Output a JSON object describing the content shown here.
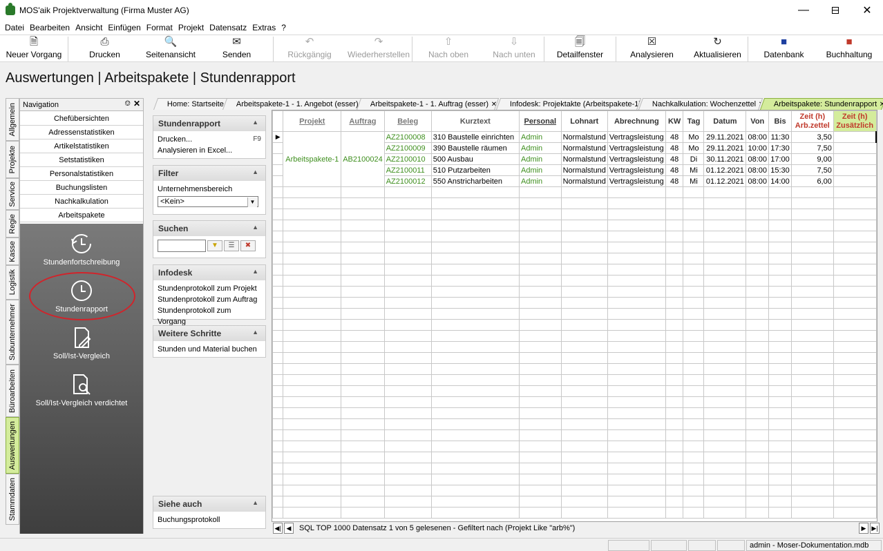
{
  "window": {
    "title": "MOS'aik Projektverwaltung (Firma Muster AG)"
  },
  "menu": [
    "Datei",
    "Bearbeiten",
    "Ansicht",
    "Einfügen",
    "Format",
    "Projekt",
    "Datensatz",
    "Extras",
    "?"
  ],
  "toolbar": {
    "neuer_vorgang": "Neuer Vorgang",
    "drucken": "Drucken",
    "seitenansicht": "Seitenansicht",
    "senden": "Senden",
    "rueckgaengig": "Rückgängig",
    "wiederherstellen": "Wiederherstellen",
    "nach_oben": "Nach oben",
    "nach_unten": "Nach unten",
    "detailfenster": "Detailfenster",
    "analysieren": "Analysieren",
    "aktualisieren": "Aktualisieren",
    "datenbank": "Datenbank",
    "buchhaltung": "Buchhaltung"
  },
  "page_title": "Auswertungen | Arbeitspakete | Stundenrapport",
  "vertical_tabs": [
    "Allgemein",
    "Projekte",
    "Service",
    "Regie",
    "Kasse",
    "Logistik",
    "Subunternehmer",
    "Büroarbeiten",
    "Auswertungen",
    "Stammdaten"
  ],
  "navigation": {
    "title": "Navigation",
    "items": [
      "Chefübersichten",
      "Adressenstatistiken",
      "Artikelstatistiken",
      "Setstatistiken",
      "Personalstatistiken",
      "Buchungslisten",
      "Nachkalkulation",
      "Arbeitspakete"
    ],
    "icons": [
      "Stundenfortschreibung",
      "Stundenrapport",
      "Soll/Ist-Vergleich",
      "Soll/Ist-Vergleich verdichtet"
    ]
  },
  "tasks": {
    "stundenrapport": {
      "title": "Stundenrapport",
      "drucken": "Drucken...",
      "drucken_key": "F9",
      "analysieren": "Analysieren in Excel..."
    },
    "filter": {
      "title": "Filter",
      "label": "Unternehmensbereich",
      "value": "<Kein>"
    },
    "suchen": {
      "title": "Suchen"
    },
    "infodesk": {
      "title": "Infodesk",
      "items": [
        "Stundenprotokoll zum Projekt",
        "Stundenprotokoll zum Auftrag",
        "Stundenprotokoll zum Vorgang"
      ]
    },
    "weitere": {
      "title": "Weitere Schritte",
      "items": [
        "Stunden und Material buchen"
      ]
    },
    "siehe": {
      "title": "Siehe auch",
      "items": [
        "Buchungsprotokoll"
      ]
    }
  },
  "doc_tabs": [
    "Home: Startseite",
    "Arbeitspakete-1 - 1. Angebot (esser)",
    "Arbeitspakete-1 - 1. Auftrag (esser)",
    "Infodesk: Projektakte (Arbeitspakete-1)",
    "Nachkalkulation: Wochenzettel",
    "Arbeitspakete: Stundenrapport"
  ],
  "grid": {
    "headers": {
      "projekt": "Projekt",
      "auftrag": "Auftrag",
      "beleg": "Beleg",
      "kurztext": "Kurztext",
      "personal": "Personal",
      "lohnart": "Lohnart",
      "abrechnung": "Abrechnung",
      "kw": "KW",
      "tag": "Tag",
      "datum": "Datum",
      "von": "Von",
      "bis": "Bis",
      "zeit1a": "Zeit (h)",
      "zeit1b": "Arb.zettel",
      "zeit2a": "Zeit (h)",
      "zeit2b": "Zusätzlich"
    },
    "projekt": "Arbeitspakete-1",
    "auftrag": "AB2100024",
    "rows": [
      {
        "beleg": "AZ2100008",
        "kurztext": "310 Baustelle einrichten",
        "personal": "Admin",
        "lohnart": "Normalstund",
        "abrechnung": "Vertragsleistung",
        "kw": "48",
        "tag": "Mo",
        "datum": "29.11.2021",
        "von": "08:00",
        "bis": "11:30",
        "zeit": "3,50"
      },
      {
        "beleg": "AZ2100009",
        "kurztext": "390 Baustelle räumen",
        "personal": "Admin",
        "lohnart": "Normalstund",
        "abrechnung": "Vertragsleistung",
        "kw": "48",
        "tag": "Mo",
        "datum": "29.11.2021",
        "von": "10:00",
        "bis": "17:30",
        "zeit": "7,50"
      },
      {
        "beleg": "AZ2100010",
        "kurztext": "500 Ausbau",
        "personal": "Admin",
        "lohnart": "Normalstund",
        "abrechnung": "Vertragsleistung",
        "kw": "48",
        "tag": "Di",
        "datum": "30.11.2021",
        "von": "08:00",
        "bis": "17:00",
        "zeit": "9,00"
      },
      {
        "beleg": "AZ2100011",
        "kurztext": "510 Putzarbeiten",
        "personal": "Admin",
        "lohnart": "Normalstund",
        "abrechnung": "Vertragsleistung",
        "kw": "48",
        "tag": "Mi",
        "datum": "01.12.2021",
        "von": "08:00",
        "bis": "15:30",
        "zeit": "7,50"
      },
      {
        "beleg": "AZ2100012",
        "kurztext": "550 Anstricharbeiten",
        "personal": "Admin",
        "lohnart": "Normalstund",
        "abrechnung": "Vertragsleistung",
        "kw": "48",
        "tag": "Mi",
        "datum": "01.12.2021",
        "von": "08:00",
        "bis": "14:00",
        "zeit": "6,00"
      }
    ]
  },
  "record_nav": {
    "text": "SQL TOP 1000 Datensatz 1 von 5 gelesenen - Gefiltert nach (Projekt Like \"arb%\")"
  },
  "status": {
    "db": "admin - Moser-Dokumentation.mdb"
  }
}
